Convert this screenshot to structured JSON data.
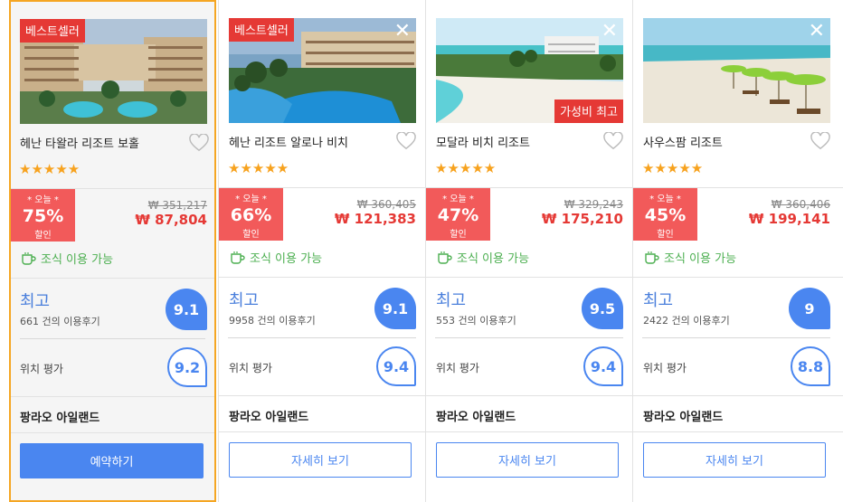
{
  "hotels": [
    {
      "badge_best": "베스트셀러",
      "name": "헤난 타왈라 리조트 보홀",
      "stars": "★★★★★",
      "today": "* 오늘 *",
      "discount": "75%",
      "discount_off": "할인",
      "original_price": "₩ 351,217",
      "final_price": "₩ 87,804",
      "breakfast": "조식 이용 가능",
      "grade": "최고",
      "reviews": "661 건의 이용후기",
      "score": "9.1",
      "location_label": "위치 평가",
      "location_score": "9.2",
      "region": "팡라오 아일랜드",
      "button": "예약하기"
    },
    {
      "badge_best": "베스트셀러",
      "close": "✕",
      "name": "헤난 리조트 알로나 비치",
      "stars": "★★★★★",
      "today": "* 오늘 *",
      "discount": "66%",
      "discount_off": "할인",
      "original_price": "₩ 360,405",
      "final_price": "₩ 121,383",
      "breakfast": "조식 이용 가능",
      "grade": "최고",
      "reviews": "9958 건의 이용후기",
      "score": "9.1",
      "location_label": "위치 평가",
      "location_score": "9.4",
      "region": "팡라오 아일랜드",
      "button": "자세히 보기"
    },
    {
      "badge_value": "가성비 최고",
      "close": "✕",
      "name": "모달라 비치 리조트",
      "stars": "★★★★★",
      "today": "* 오늘 *",
      "discount": "47%",
      "discount_off": "할인",
      "original_price": "₩ 329,243",
      "final_price": "₩ 175,210",
      "breakfast": "조식 이용 가능",
      "grade": "최고",
      "reviews": "553 건의 이용후기",
      "score": "9.5",
      "location_label": "위치 평가",
      "location_score": "9.4",
      "region": "팡라오 아일랜드",
      "button": "자세히 보기"
    },
    {
      "close": "✕",
      "name": "사우스팜 리조트",
      "stars": "★★★★★",
      "today": "* 오늘 *",
      "discount": "45%",
      "discount_off": "할인",
      "original_price": "₩ 360,406",
      "final_price": "₩ 199,141",
      "breakfast": "조식 이용 가능",
      "grade": "최고",
      "reviews": "2422 건의 이용후기",
      "score": "9",
      "location_label": "위치 평가",
      "location_score": "8.8",
      "region": "팡라오 아일랜드",
      "button": "자세히 보기"
    }
  ],
  "colors": {
    "selected_border": "#f5a623",
    "discount_bg": "#f25a5a",
    "price_red": "#e53935",
    "score_blue": "#4a86f0",
    "grade_blue": "#4a7fdc",
    "breakfast_green": "#4caf50",
    "star_orange": "#f7a21e"
  },
  "icons": [
    "heart-outline-icon",
    "coffee-cup-icon",
    "close-icon",
    "star-icon"
  ]
}
